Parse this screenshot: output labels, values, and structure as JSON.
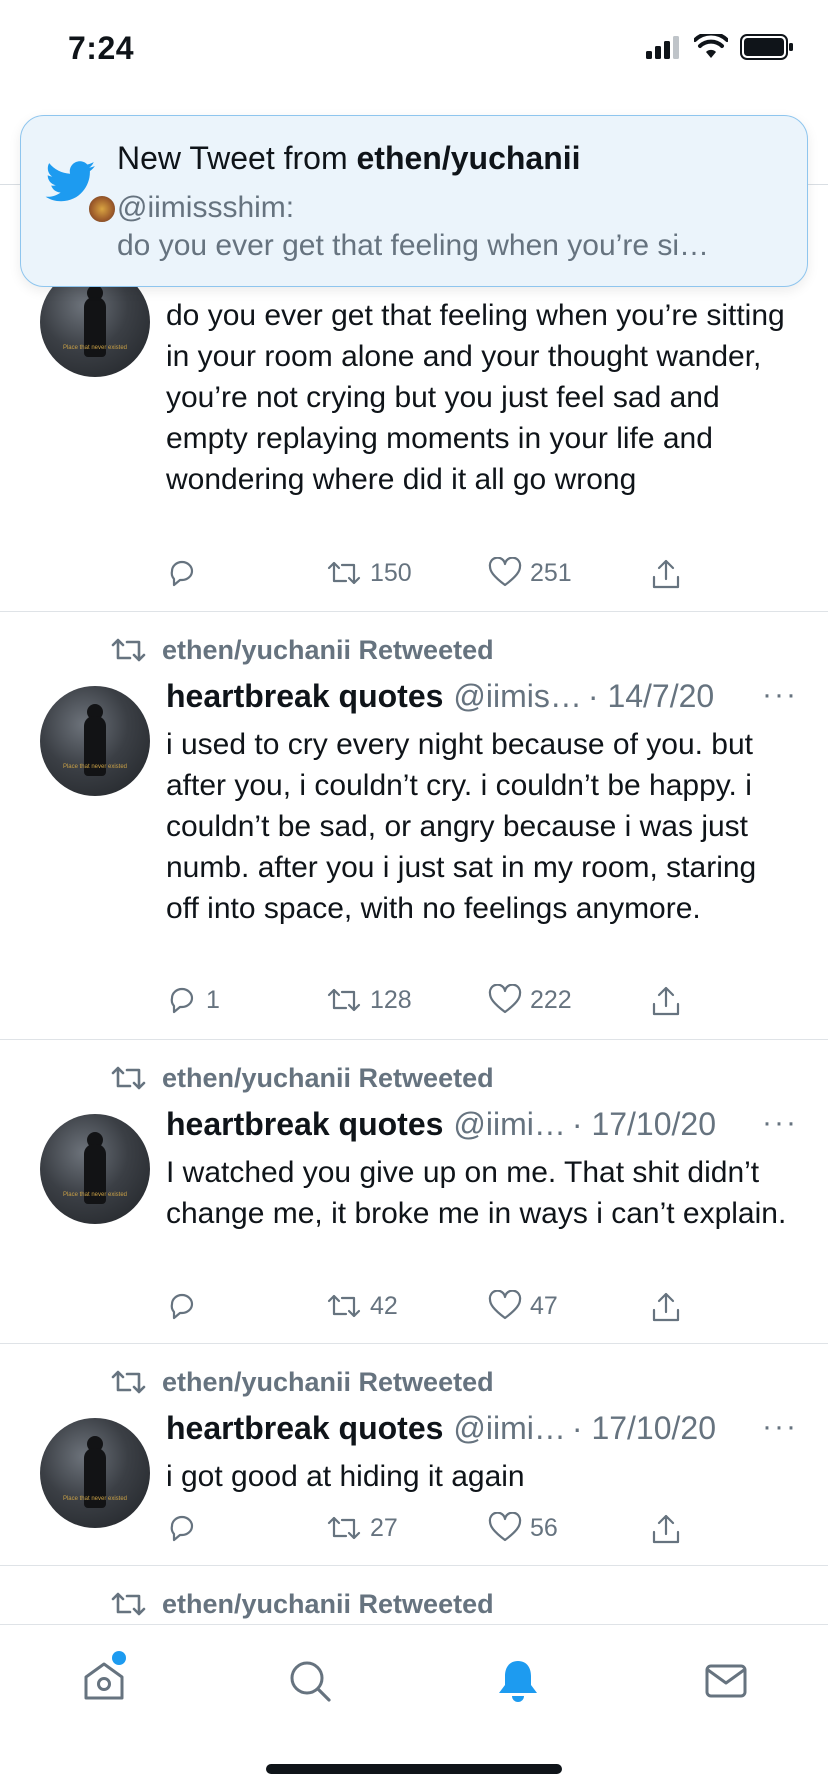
{
  "status_bar": {
    "time": "7:24"
  },
  "banner": {
    "title_prefix": "New Tweet from ",
    "title_user": "ethen/yuchanii",
    "handle": "@iimissshim:",
    "preview": "do you ever get that feeling when you’re si…"
  },
  "retweet_label": "ethen/yuchanii Retweeted",
  "tweets": [
    {
      "text": "do you ever get that feeling when you’re sitting in your room alone and your thought wander, you’re not crying but you just feel sad and empty replaying moments in your life and wondering where did it all go wrong",
      "replies": "",
      "retweets": "150",
      "likes": "251"
    },
    {
      "name": "heartbreak quotes",
      "handle": "@iimis…",
      "date": "· 14/7/20",
      "text": "i used to cry every night because of you. but after you, i couldn’t cry. i couldn’t be happy. i couldn’t be sad, or angry because i was just numb. after you i just sat in my room, staring off into space, with no feelings anymore.",
      "replies": "1",
      "retweets": "128",
      "likes": "222"
    },
    {
      "name": "heartbreak quotes",
      "handle": "@iimi…",
      "date": "· 17/10/20",
      "text": "I watched you give up on me. That shit didn’t change me, it broke me in ways i can’t explain.",
      "replies": "",
      "retweets": "42",
      "likes": "47"
    },
    {
      "name": "heartbreak quotes",
      "handle": "@iimi…",
      "date": "· 17/10/20",
      "text": "i got good at hiding it again",
      "replies": "",
      "retweets": "27",
      "likes": "56"
    }
  ],
  "more_label": "···",
  "avatar_caption": "Place that never existed",
  "colors": {
    "accent": "#1d9bf0",
    "secondary_text": "#66737f",
    "banner_bg": "#ebf4fb"
  },
  "icons": {
    "reply": "reply-icon",
    "retweet": "retweet-icon",
    "like": "heart-icon",
    "share": "share-icon",
    "home": "home-icon",
    "search": "search-icon",
    "notifications": "bell-icon",
    "messages": "mail-icon"
  }
}
